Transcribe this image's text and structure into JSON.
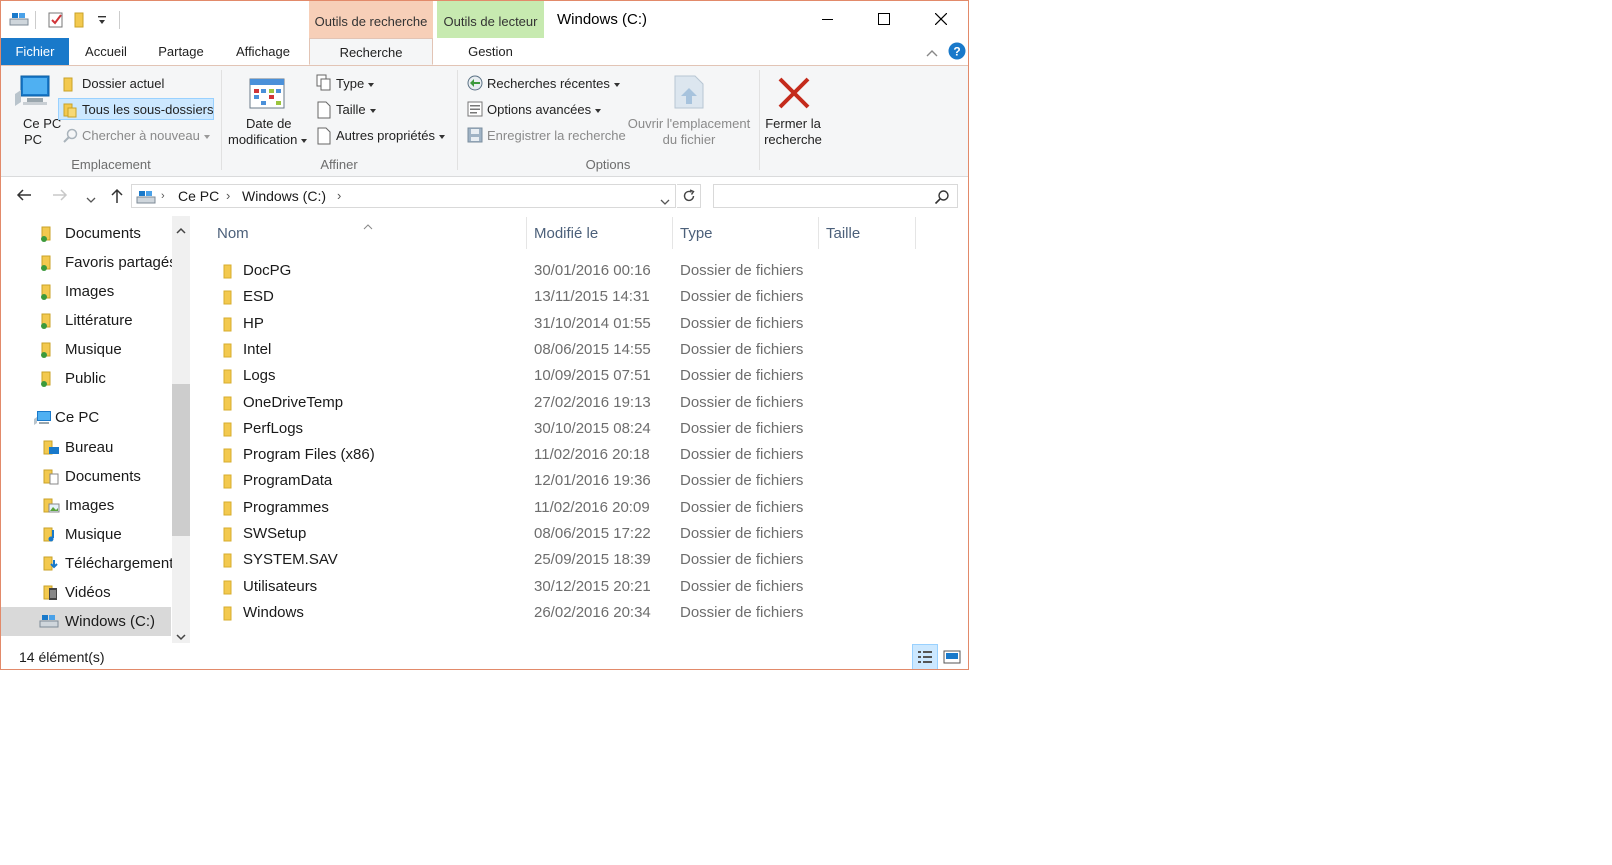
{
  "window": {
    "title": "Windows (C:)",
    "context_tabs": {
      "search_tools": "Outils de recherche",
      "drive_tools": "Outils de lecteur"
    }
  },
  "tabs": [
    {
      "label": "Fichier"
    },
    {
      "label": "Accueil"
    },
    {
      "label": "Partage"
    },
    {
      "label": "Affichage"
    },
    {
      "label": "Recherche"
    },
    {
      "label": "Gestion"
    }
  ],
  "ribbon": {
    "location": {
      "this_pc": "Ce PC",
      "current_folder": "Dossier actuel",
      "all_subfolders": "Tous les sous-dossiers",
      "search_again": "Chercher à nouveau",
      "label": "Emplacement"
    },
    "refine": {
      "date_modified_1": "Date de",
      "date_modified_2": "modification",
      "type": "Type",
      "size": "Taille",
      "other_props": "Autres propriétés",
      "label": "Affiner"
    },
    "options": {
      "recent_searches": "Recherches récentes",
      "advanced_options": "Options avancées",
      "save_search": "Enregistrer la recherche",
      "open_location_1": "Ouvrir l'emplacement",
      "open_location_2": "du fichier",
      "label": "Options"
    },
    "close": {
      "line1": "Fermer la",
      "line2": "recherche"
    }
  },
  "address": {
    "crumbs": [
      "Ce PC",
      "Windows (C:)"
    ]
  },
  "search": {
    "placeholder": ""
  },
  "nav": {
    "items": [
      {
        "label": "Documents"
      },
      {
        "label": "Favoris partagés"
      },
      {
        "label": "Images"
      },
      {
        "label": "Littérature"
      },
      {
        "label": "Musique"
      },
      {
        "label": "Public"
      },
      {
        "label": "Ce PC"
      },
      {
        "label": "Bureau"
      },
      {
        "label": "Documents"
      },
      {
        "label": "Images"
      },
      {
        "label": "Musique"
      },
      {
        "label": "Téléchargements"
      },
      {
        "label": "Vidéos"
      },
      {
        "label": "Windows (C:)"
      }
    ]
  },
  "columns": {
    "name": "Nom",
    "modified": "Modifié le",
    "type": "Type",
    "size": "Taille"
  },
  "files": [
    {
      "name": "DocPG",
      "modified": "30/01/2016 00:16",
      "type": "Dossier de fichiers"
    },
    {
      "name": "ESD",
      "modified": "13/11/2015 14:31",
      "type": "Dossier de fichiers"
    },
    {
      "name": "HP",
      "modified": "31/10/2014 01:55",
      "type": "Dossier de fichiers"
    },
    {
      "name": "Intel",
      "modified": "08/06/2015 14:55",
      "type": "Dossier de fichiers"
    },
    {
      "name": "Logs",
      "modified": "10/09/2015 07:51",
      "type": "Dossier de fichiers"
    },
    {
      "name": "OneDriveTemp",
      "modified": "27/02/2016 19:13",
      "type": "Dossier de fichiers"
    },
    {
      "name": "PerfLogs",
      "modified": "30/10/2015 08:24",
      "type": "Dossier de fichiers"
    },
    {
      "name": "Program Files (x86)",
      "modified": "11/02/2016 20:18",
      "type": "Dossier de fichiers"
    },
    {
      "name": "ProgramData",
      "modified": "12/01/2016 19:36",
      "type": "Dossier de fichiers"
    },
    {
      "name": "Programmes",
      "modified": "11/02/2016 20:09",
      "type": "Dossier de fichiers"
    },
    {
      "name": "SWSetup",
      "modified": "08/06/2015 17:22",
      "type": "Dossier de fichiers"
    },
    {
      "name": "SYSTEM.SAV",
      "modified": "25/09/2015 18:39",
      "type": "Dossier de fichiers"
    },
    {
      "name": "Utilisateurs",
      "modified": "30/12/2015 20:21",
      "type": "Dossier de fichiers"
    },
    {
      "name": "Windows",
      "modified": "26/02/2016 20:34",
      "type": "Dossier de fichiers"
    }
  ],
  "status": {
    "count": "14 élément(s)"
  },
  "colors": {
    "accent": "#1979ca",
    "search_tab": "#f7cfb8",
    "drive_tab": "#c7eab0",
    "close_x": "#c42b1c",
    "folder": "#f3c94f"
  }
}
